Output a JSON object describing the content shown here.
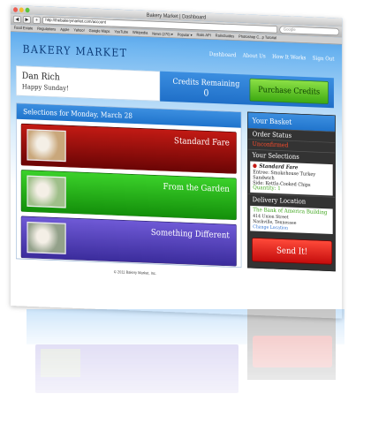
{
  "browser": {
    "window_title": "Bakery Market | Dashboard",
    "url": "http://thebakerymarket.com/account",
    "search_placeholder": "Google",
    "back": "◀",
    "forward": "▶",
    "add": "+",
    "bookmarks": [
      "Food Estate",
      "Regulations",
      "Apple",
      "Yahoo!",
      "Google Maps",
      "YouTube",
      "Wikipedia",
      "News (270) ▾",
      "Popular ▾",
      "Rails API",
      "RailsGuides",
      "Photoshop C...p Tutorial"
    ]
  },
  "site": {
    "logo": "BAKERY MARKET",
    "nav": [
      "Dashboard",
      "About Us",
      "How It Works",
      "Sign Out"
    ]
  },
  "user": {
    "name": "Dan Rich",
    "greeting": "Happy Sunday!"
  },
  "credits": {
    "label": "Credits Remaining",
    "value": "0",
    "button": "Purchase Credits"
  },
  "selections": {
    "header": "Selections for Monday, March 28",
    "meals": [
      {
        "title": "Standard Fare",
        "color_top": "#c21a14",
        "color_bottom": "#6b0505",
        "thumb": "#c9a77b"
      },
      {
        "title": "From the Garden",
        "color_top": "#3bd12a",
        "color_bottom": "#138f0a",
        "thumb": "#9fbf8a"
      },
      {
        "title": "Something Different",
        "color_top": "#6f5ad6",
        "color_bottom": "#3b2c9c",
        "thumb": "#93a18a"
      }
    ]
  },
  "basket": {
    "header": "Your Basket",
    "order_status_label": "Order Status",
    "order_status_value": "Unconfirmed",
    "selections_label": "Your Selections",
    "item_name": "Standard Fare",
    "entree": "Entree: Smokehouse Turkey Sandwich",
    "side": "Side: Kettle-Cooked Chips",
    "quantity": "Quantity: 1",
    "delivery_label": "Delivery Location",
    "location_name": "The Bank of America Building",
    "address_line1": "414 Union Street",
    "address_line2": "Nashville, Tennessee",
    "change_location": "Change Location",
    "send_button": "Send It!"
  },
  "footer": "© 2011 Bakery Market, Inc."
}
